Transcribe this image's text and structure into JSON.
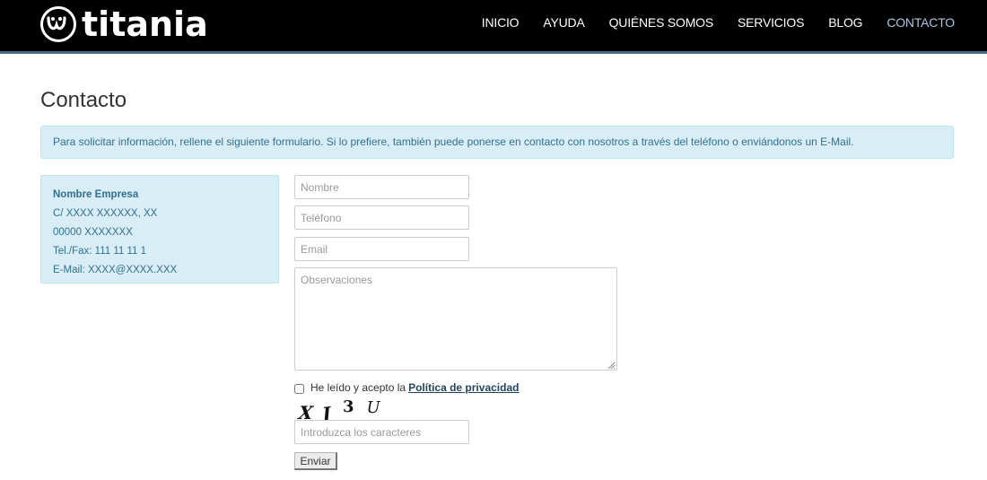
{
  "brand": {
    "name": "titania"
  },
  "nav": {
    "items": [
      {
        "label": "INICIO"
      },
      {
        "label": "AYUDA"
      },
      {
        "label": "QUIÉNES SOMOS"
      },
      {
        "label": "SERVICIOS"
      },
      {
        "label": "BLOG"
      },
      {
        "label": "CONTACTO",
        "active": true
      }
    ],
    "active_color": "#a9c8e0"
  },
  "page": {
    "title": "Contacto",
    "intro": "Para solicitar información, rellene el siguiente formulario. Si lo prefiere, también puede ponerse en contacto con nosotros a través del teléfono o enviándonos un E-Mail."
  },
  "address": {
    "name": "Nombre Empresa",
    "street": "C/ XXXX XXXXXX, XX",
    "postal": "00000 XXXXXXX",
    "phone": "Tel./Fax: 111 11 11 1",
    "email": "E-Mail: XXXX@XXXX.XXX"
  },
  "form": {
    "name_placeholder": "Nombre",
    "phone_placeholder": "Teléfono",
    "email_placeholder": "Email",
    "notes_placeholder": "Observaciones",
    "privacy_text": "He leído y acepto la",
    "privacy_link": "Política de privacidad",
    "captcha_chars": [
      "X",
      "J",
      "3",
      "U"
    ],
    "captcha_placeholder": "Introduzca los caracteres",
    "submit_label": "Enviar"
  },
  "colors": {
    "header_bg": "#000000",
    "alert_bg": "#d9edf7",
    "alert_text": "#31708f"
  }
}
